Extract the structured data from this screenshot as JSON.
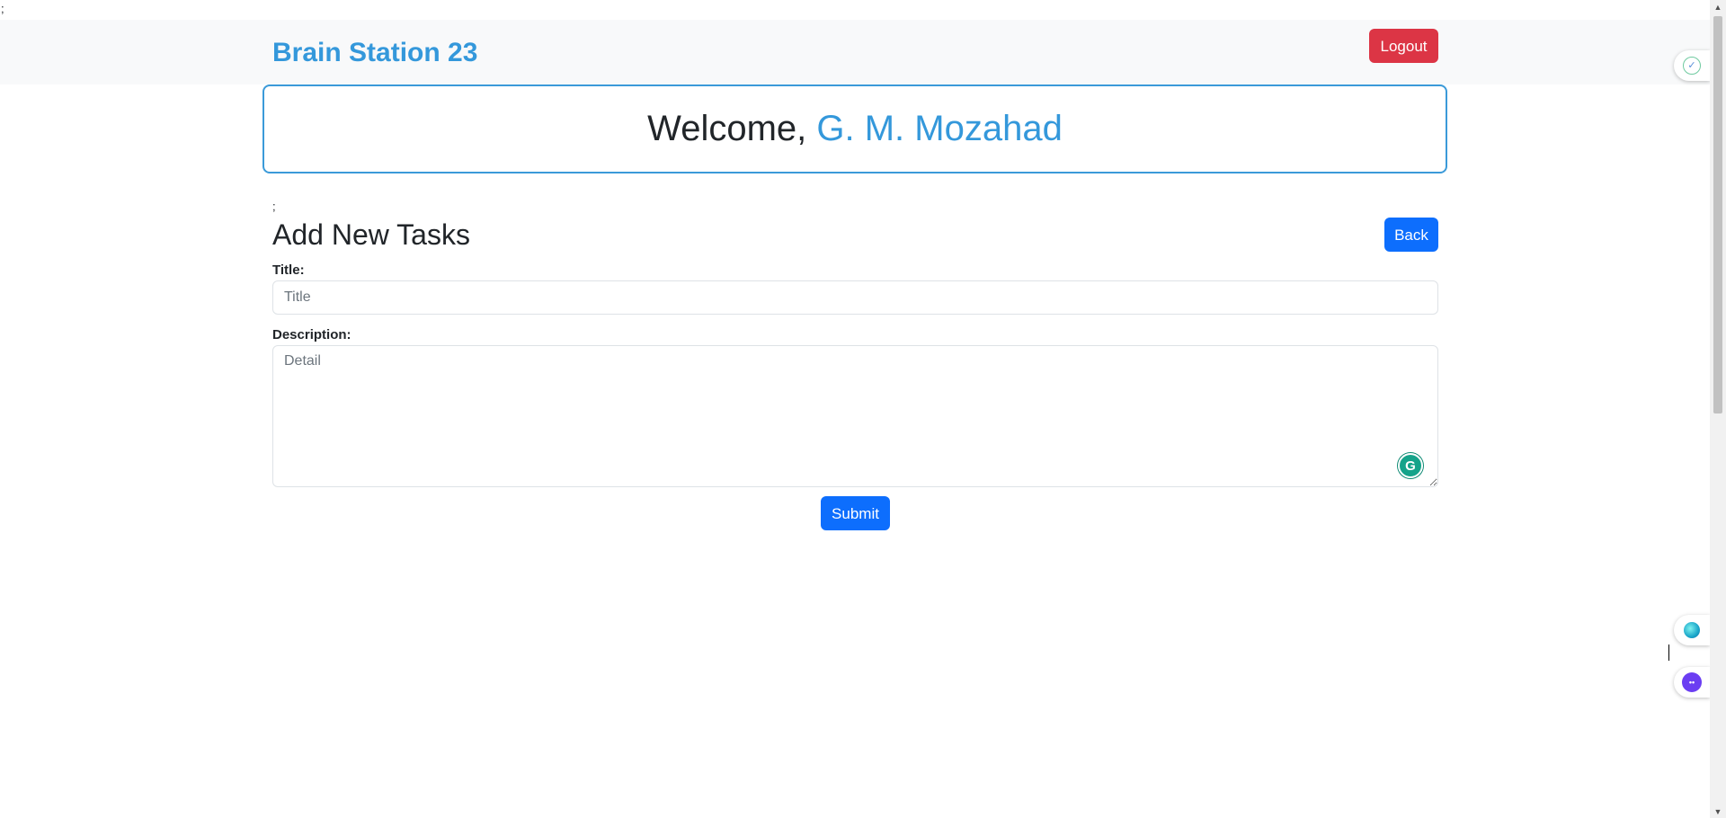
{
  "page": {
    "stray_top_text": ";",
    "stray_mid_text": ";"
  },
  "navbar": {
    "brand": "Brain Station 23",
    "logout_label": "Logout"
  },
  "welcome": {
    "prefix": "Welcome, ",
    "name": "G. M. Mozahad"
  },
  "form": {
    "heading": "Add New Tasks",
    "back_label": "Back",
    "title_label": "Title:",
    "title_placeholder": "Title",
    "title_value": "",
    "description_label": "Description:",
    "description_placeholder": "Detail",
    "description_value": "",
    "submit_label": "Submit"
  },
  "extensions": {
    "grammarly_glyph": "G",
    "icon_names": [
      "extension-icon",
      "assistant-orb-icon",
      "bot-face-icon"
    ],
    "bot_glyph": "••"
  },
  "colors": {
    "brand": "#3498db",
    "danger": "#dc3545",
    "primary": "#0d6efd",
    "navbar_bg": "#f8f9fa",
    "welcome_border": "#3b9ad9",
    "grammarly": "#15a38a"
  }
}
